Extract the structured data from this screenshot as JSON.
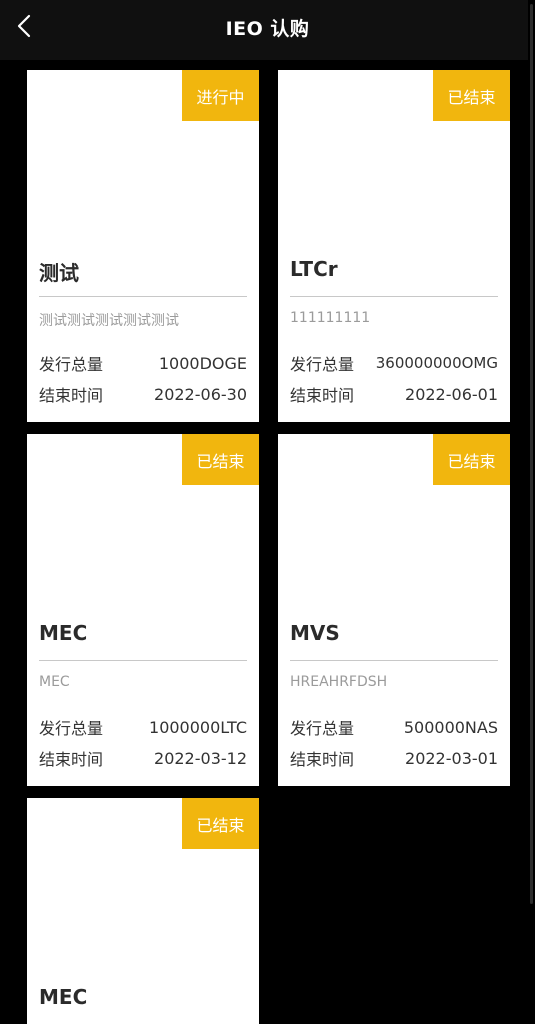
{
  "header": {
    "title": "IEO 认购",
    "back_icon": "chevron-left-icon"
  },
  "labels": {
    "total": "发行总量",
    "end_time": "结束时间"
  },
  "colors": {
    "badge": "#f1b60e",
    "header": "#101010",
    "background": "#000000"
  },
  "cards": [
    {
      "status": "进行中",
      "name": "测试",
      "desc": "测试测试测试测试测试",
      "total": "1000DOGE",
      "end_time": "2022-06-30"
    },
    {
      "status": "已结束",
      "name": "LTCr",
      "desc": "111111111",
      "total": "360000000OMG",
      "end_time": "2022-06-01"
    },
    {
      "status": "已结束",
      "name": "MEC",
      "desc": "MEC",
      "total": "1000000LTC",
      "end_time": "2022-03-12"
    },
    {
      "status": "已结束",
      "name": "MVS",
      "desc": "HREAHRFDSH",
      "total": "500000NAS",
      "end_time": "2022-03-01"
    },
    {
      "status": "已结束",
      "name": "MEC",
      "desc": "",
      "total": "",
      "end_time": ""
    }
  ]
}
